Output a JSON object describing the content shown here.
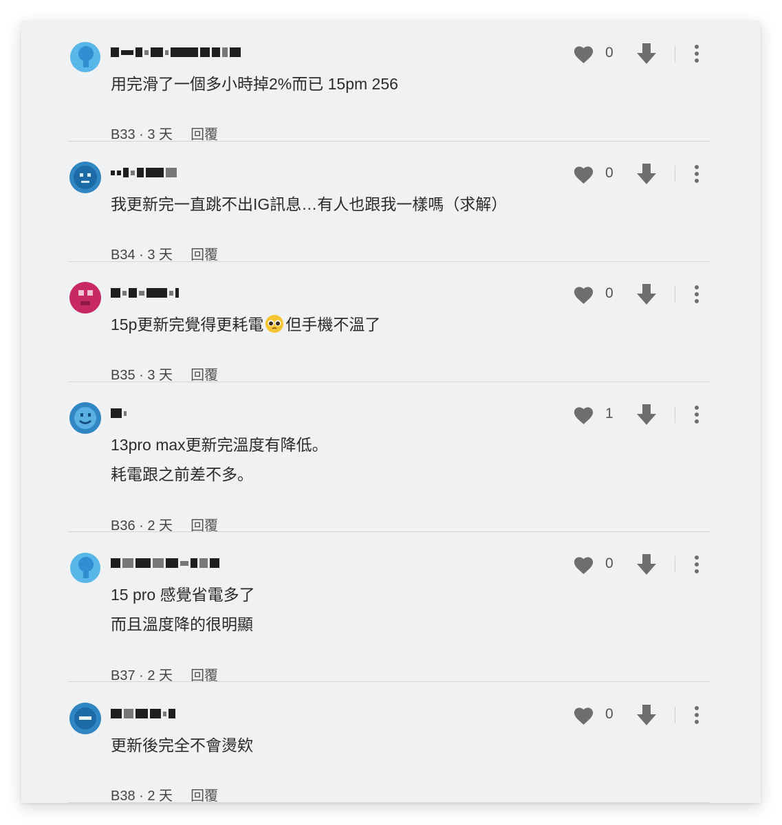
{
  "comments": [
    {
      "text_lines": [
        "用完滑了一個多小時掉2%而已 15pm 256"
      ],
      "floor": "B33",
      "time": "3 天",
      "reply": "回覆",
      "likes": "0",
      "avatar_color": "#59b6e8",
      "avatar_style": "pin"
    },
    {
      "text_lines": [
        "我更新完一直跳不出IG訊息…有人也跟我一樣嗎（求解）"
      ],
      "floor": "B34",
      "time": "3 天",
      "reply": "回覆",
      "likes": "0",
      "avatar_color": "#2f86c2",
      "avatar_style": "face"
    },
    {
      "text_lines": [
        "15p更新完覺得更耗電",
        "但手機不溫了"
      ],
      "emoji": "pleading-face-emoji",
      "floor": "B35",
      "time": "3 天",
      "reply": "回覆",
      "likes": "0",
      "avatar_color": "#c72a62",
      "avatar_style": "face"
    },
    {
      "text_lines": [
        "13pro max更新完溫度有降低。",
        "耗電跟之前差不多。"
      ],
      "floor": "B36",
      "time": "2 天",
      "reply": "回覆",
      "likes": "1",
      "avatar_color": "#2f86c2",
      "avatar_style": "smile"
    },
    {
      "text_lines": [
        "15 pro 感覺省電多了",
        "而且溫度降的很明顯"
      ],
      "floor": "B37",
      "time": "2 天",
      "reply": "回覆",
      "likes": "0",
      "avatar_color": "#59b6e8",
      "avatar_style": "pin"
    },
    {
      "text_lines": [
        "更新後完全不會燙欸"
      ],
      "floor": "B38",
      "time": "2 天",
      "reply": "回覆",
      "likes": "0",
      "avatar_color": "#2f86c2",
      "avatar_style": "flat"
    }
  ],
  "icons": {
    "like": "heart-icon",
    "dislike": "arrow-down-icon",
    "more": "more-vertical-icon",
    "emoji": "pleading-face-emoji"
  },
  "colors": {
    "background": "#f0f1f3",
    "icon": "#6e6e6e",
    "text": "#2b2b2b"
  }
}
